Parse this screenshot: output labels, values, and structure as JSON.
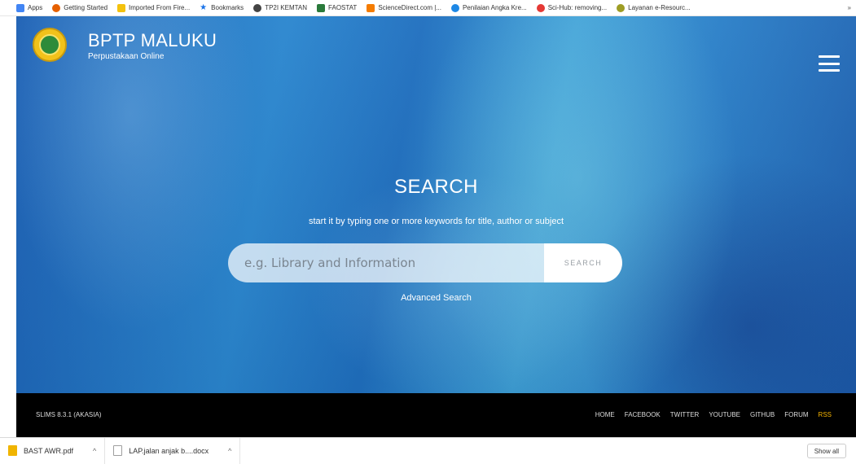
{
  "bookmarks": {
    "items": [
      {
        "label": "Apps",
        "color": "#4285f4"
      },
      {
        "label": "Getting Started",
        "color": "#e66000"
      },
      {
        "label": "Imported From Fire...",
        "color": "#f4c20d"
      },
      {
        "label": "Bookmarks",
        "color": "#1a73e8"
      },
      {
        "label": "TP2I KEMTAN",
        "color": "#444444"
      },
      {
        "label": "FAOSTAT",
        "color": "#2a7a3b"
      },
      {
        "label": "ScienceDirect.com |...",
        "color": "#f57c00"
      },
      {
        "label": "Penilaian Angka Kre...",
        "color": "#1e88e5"
      },
      {
        "label": "Sci-Hub: removing...",
        "color": "#e53935"
      },
      {
        "label": "Layanan e-Resourc...",
        "color": "#9e9d24"
      }
    ],
    "more": "»"
  },
  "header": {
    "title": "BPTP MALUKU",
    "subtitle": "Perpustakaan Online"
  },
  "search": {
    "title": "SEARCH",
    "subtitle": "start it by typing one or more keywords for title, author or subject",
    "placeholder": "e.g. Library and Information",
    "button": "SEARCH",
    "advanced": "Advanced Search"
  },
  "footer": {
    "version": "SLIMS 8.3.1 (AKASIA)",
    "links": [
      "HOME",
      "FACEBOOK",
      "TWITTER",
      "YOUTUBE",
      "GITHUB",
      "FORUM",
      "RSS"
    ]
  },
  "downloads": {
    "items": [
      {
        "name": "BAST AWR.pdf",
        "color": "#f0b400"
      },
      {
        "name": "LAP.jalan anjak b....docx",
        "color": "#9e9e9e"
      }
    ],
    "caret": "^",
    "show_all": "Show all"
  }
}
